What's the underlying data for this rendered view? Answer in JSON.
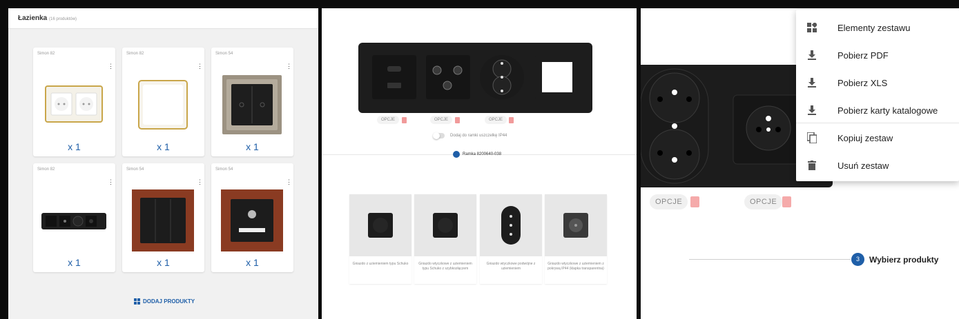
{
  "panel1": {
    "title": "Łazienka",
    "count": "(16 produktów)",
    "cards": [
      {
        "brand": "Simon 82",
        "qty": "x 1",
        "icon": "double-socket-white-gold"
      },
      {
        "brand": "Simon 82",
        "qty": "x 1",
        "icon": "blank-plate-white-gold"
      },
      {
        "brand": "Simon 54",
        "qty": "x 1",
        "icon": "blind-switch-black-steel"
      },
      {
        "brand": "Simon 82",
        "qty": "x 1",
        "icon": "black-multi-frame"
      },
      {
        "brand": "Simon 54",
        "qty": "x 1",
        "icon": "triple-switch-black-wood"
      },
      {
        "brand": "Simon 54",
        "qty": "x 1",
        "icon": "led-light-black-wood"
      }
    ],
    "add_label": "DODAJ PRODUKTY"
  },
  "panel2": {
    "opcje": "OPCJE",
    "toggle_label": "Dodaj do ramki uszczelkę IP44",
    "ramka_label": "Ramka 8200640-038",
    "products": [
      "Gniazdo z uziemieniem typu Schuko",
      "Gniazdo wtyczkowe z uziemieniem typu Schuko z szybkozłączem",
      "Gniazdo wtyczkowe podwójne z uziemieniem",
      "Gniazdo wtyczkowe z uziemieniem z pokrywą IP44 (klapka transparentna)"
    ]
  },
  "panel3": {
    "menu": [
      {
        "label": "Elementy zestawu",
        "icon": "widgets-icon"
      },
      {
        "label": "Pobierz PDF",
        "icon": "download-icon"
      },
      {
        "label": "Pobierz XLS",
        "icon": "download-icon"
      },
      {
        "label": "Pobierz karty katalogowe",
        "icon": "download-icon"
      },
      {
        "label": "Kopiuj zestaw",
        "icon": "copy-icon"
      },
      {
        "label": "Usuń zestaw",
        "icon": "delete-icon"
      }
    ],
    "opcje": "OPCJE",
    "step_number": "3",
    "step_label": "Wybierz produkty"
  },
  "colors": {
    "accent": "#1f5fa8",
    "danger": "#f19a9a"
  }
}
